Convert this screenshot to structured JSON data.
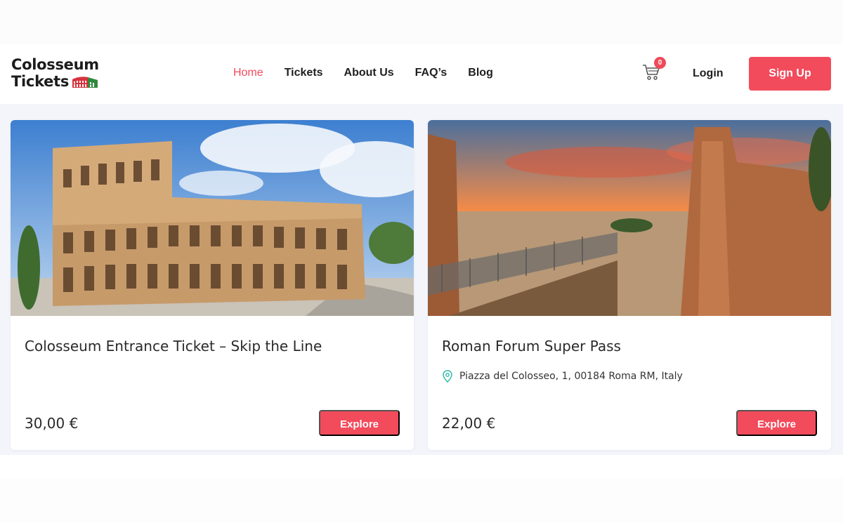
{
  "brand": {
    "name_line1": "Colosseum",
    "name_line2": "Tickets",
    "accent_color": "#f24b5c"
  },
  "nav": {
    "items": [
      {
        "label": "Home",
        "active": true
      },
      {
        "label": "Tickets",
        "active": false
      },
      {
        "label": "About Us",
        "active": false
      },
      {
        "label": "FAQ’s",
        "active": false
      },
      {
        "label": "Blog",
        "active": false
      }
    ]
  },
  "header": {
    "cart_icon": "cart-icon",
    "cart_count": "0",
    "login_label": "Login",
    "signup_label": "Sign Up"
  },
  "cards": [
    {
      "title": "Colosseum Entrance Ticket – Skip the Line",
      "location": "",
      "price": "30,00 €",
      "button_label": "Explore",
      "image": "colosseum-photo"
    },
    {
      "title": "Roman Forum Super Pass",
      "location": "Piazza del Colosseo, 1, 00184 Roma RM, Italy",
      "location_icon": "map-pin-icon",
      "price": "22,00 €",
      "button_label": "Explore",
      "image": "roman-forum-sunset-photo"
    }
  ]
}
